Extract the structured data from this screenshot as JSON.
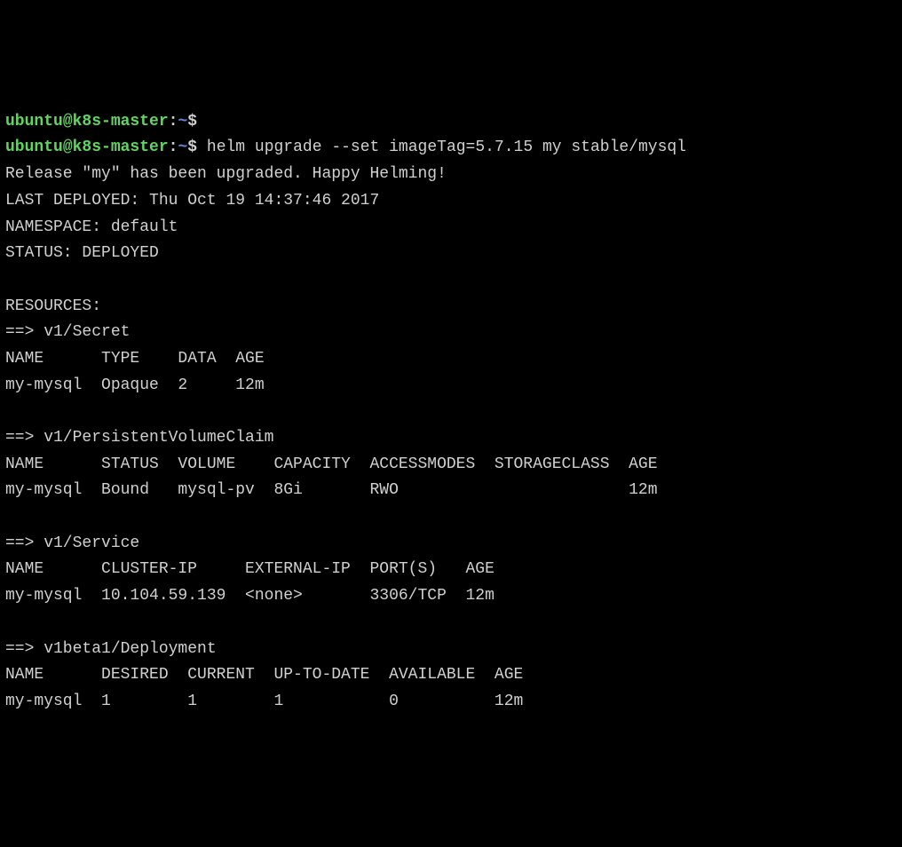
{
  "prompt": {
    "user": "ubuntu",
    "at": "@",
    "host": "k8s-master",
    "colon": ":",
    "path": "~",
    "dollar": "$"
  },
  "command": " helm upgrade --set imageTag=5.7.15 my stable/mysql",
  "output": {
    "release_msg": "Release \"my\" has been upgraded. Happy Helming!",
    "last_deployed": "LAST DEPLOYED: Thu Oct 19 14:37:46 2017",
    "namespace": "NAMESPACE: default",
    "status": "STATUS: DEPLOYED",
    "resources_label": "RESOURCES:",
    "secret": {
      "header": "==> v1/Secret",
      "cols": "NAME      TYPE    DATA  AGE",
      "row": "my-mysql  Opaque  2     12m"
    },
    "pvc": {
      "header": "==> v1/PersistentVolumeClaim",
      "cols": "NAME      STATUS  VOLUME    CAPACITY  ACCESSMODES  STORAGECLASS  AGE",
      "row": "my-mysql  Bound   mysql-pv  8Gi       RWO                        12m"
    },
    "service": {
      "header": "==> v1/Service",
      "cols": "NAME      CLUSTER-IP     EXTERNAL-IP  PORT(S)   AGE",
      "row": "my-mysql  10.104.59.139  <none>       3306/TCP  12m"
    },
    "deployment": {
      "header": "==> v1beta1/Deployment",
      "cols": "NAME      DESIRED  CURRENT  UP-TO-DATE  AVAILABLE  AGE",
      "row": "my-mysql  1        1        1           0          12m"
    }
  }
}
